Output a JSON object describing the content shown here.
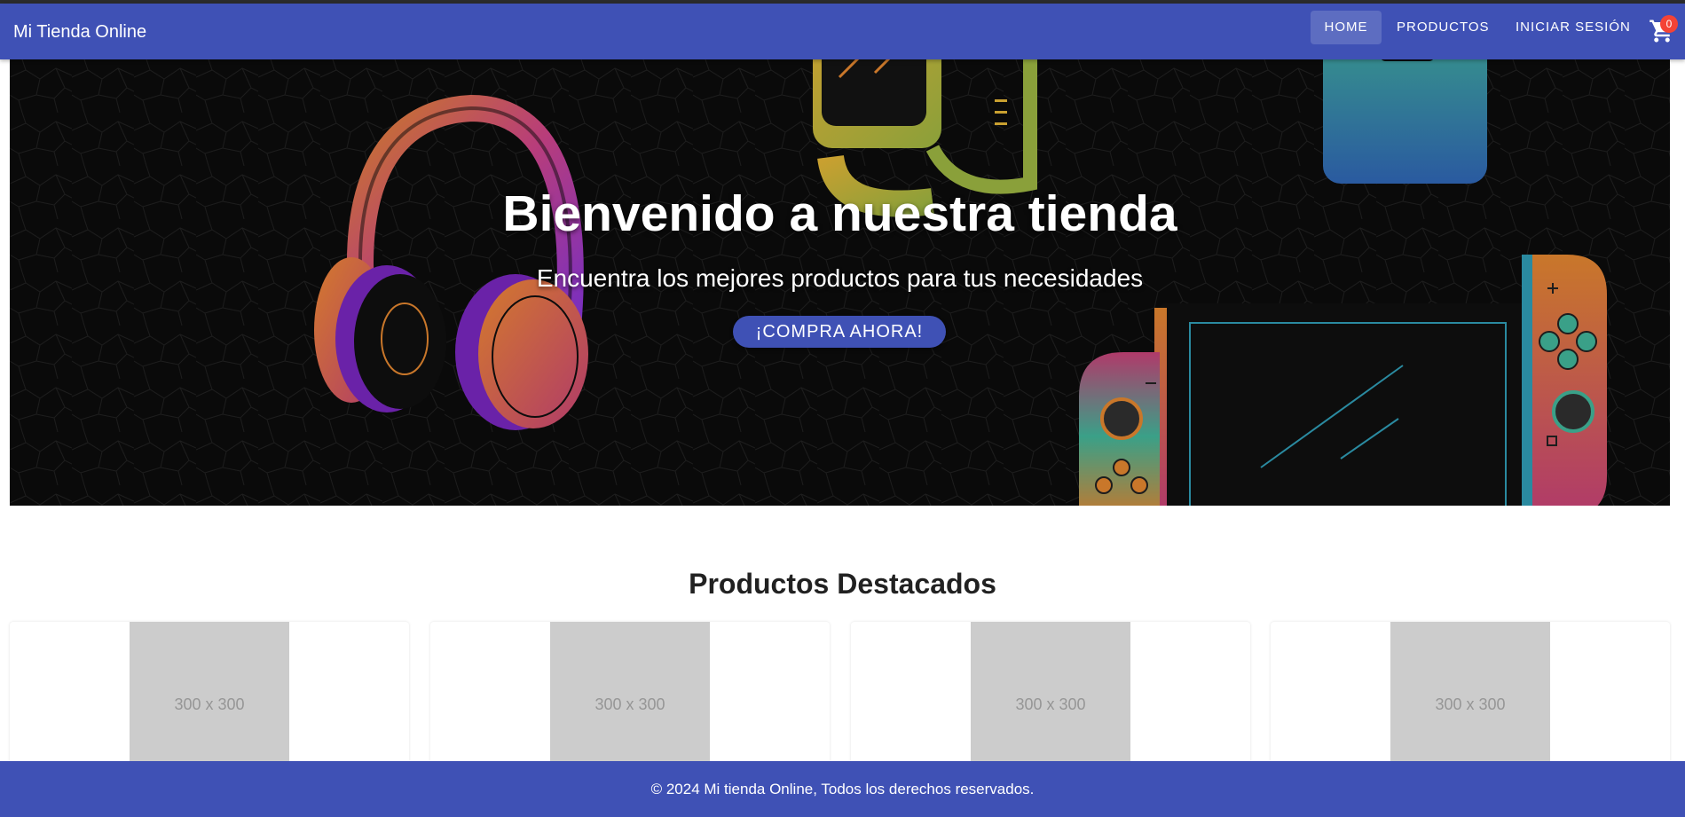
{
  "colors": {
    "primary": "#3f51b5",
    "badge": "#f44336",
    "hero_background": "#0a0a0a",
    "placeholder": "#cccccc"
  },
  "navbar": {
    "brand": "Mi Tienda Online",
    "links": [
      {
        "label": "HOME",
        "active": true
      },
      {
        "label": "PRODUCTOS",
        "active": false
      },
      {
        "label": "INICIAR SESIÓN",
        "active": false
      }
    ],
    "cart": {
      "icon": "cart-icon",
      "count": "0"
    }
  },
  "hero": {
    "title": "Bienvenido a nuestra tienda",
    "subtitle": "Encuentra los mejores productos para tus necesidades",
    "cta_label": "¡COMPRA AHORA!"
  },
  "featured": {
    "title": "Productos Destacados",
    "products": [
      {
        "image_label": "300 x 300"
      },
      {
        "image_label": "300 x 300"
      },
      {
        "image_label": "300 x 300"
      },
      {
        "image_label": "300 x 300"
      }
    ]
  },
  "footer": {
    "text": "© 2024 Mi tienda Online, Todos los derechos reservados."
  }
}
